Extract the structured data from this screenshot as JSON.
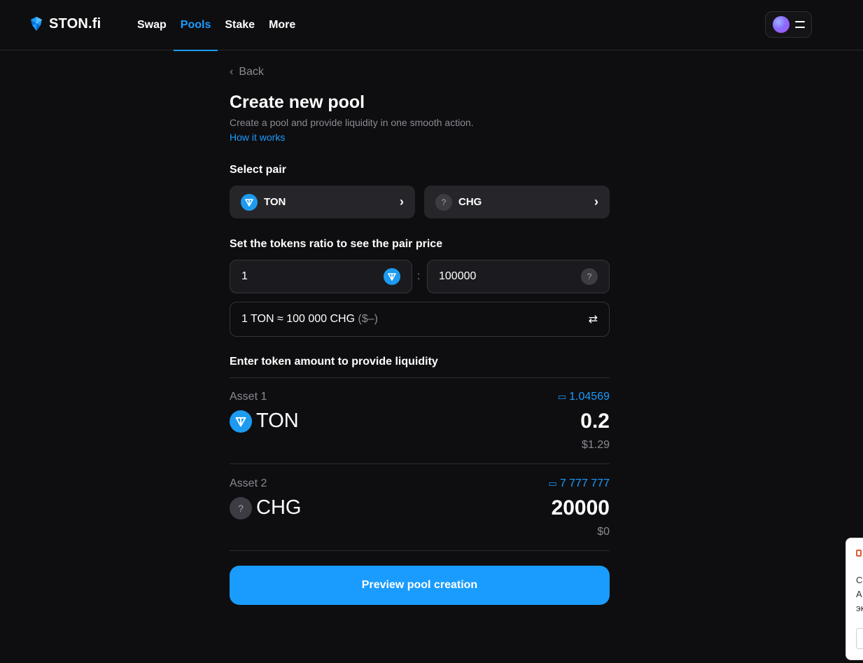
{
  "header": {
    "logo_text": "STON.fi",
    "nav": [
      {
        "label": "Swap",
        "active": false
      },
      {
        "label": "Pools",
        "active": true
      },
      {
        "label": "Stake",
        "active": false
      },
      {
        "label": "More",
        "active": false
      }
    ]
  },
  "page": {
    "back_label": "Back",
    "title": "Create new pool",
    "subtitle": "Create a pool and provide liquidity in one smooth action.",
    "how_link": "How it works"
  },
  "select_pair": {
    "label": "Select pair",
    "token_a": {
      "symbol": "TON",
      "icon": "ton-icon"
    },
    "token_b": {
      "symbol": "CHG",
      "icon": "unknown-token-icon",
      "icon_glyph": "?"
    }
  },
  "ratio": {
    "label": "Set the tokens ratio to see the pair price",
    "value_a": "1",
    "separator": ":",
    "value_b": "100000",
    "price_text": "1 TON ≈ 100 000 CHG",
    "price_usd": "($–)"
  },
  "liquidity": {
    "label": "Enter token amount to provide liquidity",
    "assets": [
      {
        "label": "Asset 1",
        "balance": "1.04569",
        "symbol": "TON",
        "amount": "0.2",
        "usd": "$1.29"
      },
      {
        "label": "Asset 2",
        "balance": "7 777 777",
        "symbol": "CHG",
        "amount": "20000",
        "usd": "$0"
      }
    ]
  },
  "preview_button": "Preview pool creation",
  "side_widget": {
    "line1": "C",
    "line2": "A",
    "line3": "эк"
  },
  "colors": {
    "accent": "#1a9cff",
    "background": "#0e0e10",
    "muted": "#8a8a93"
  }
}
